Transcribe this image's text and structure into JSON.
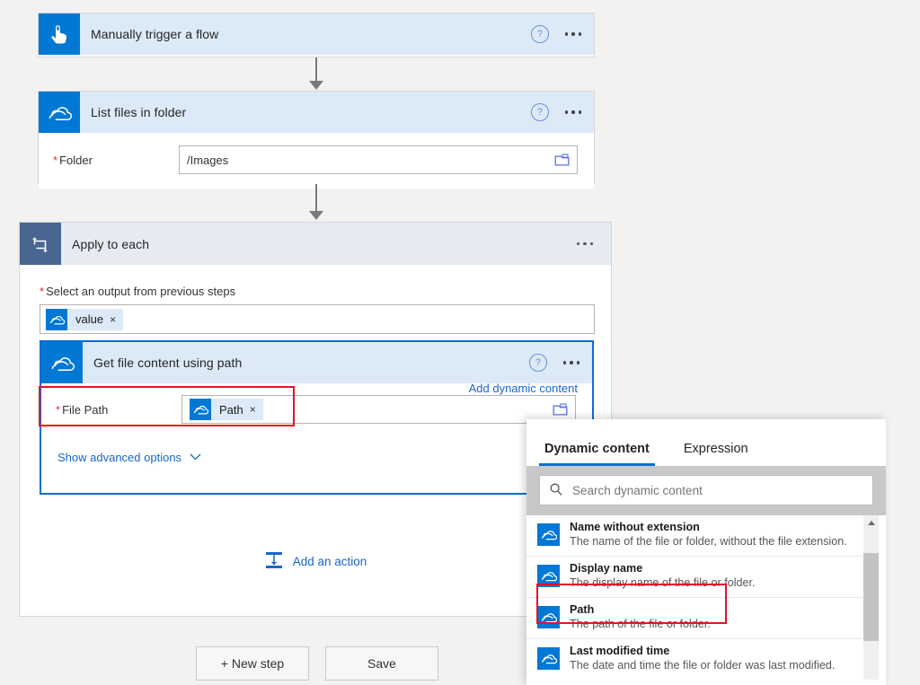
{
  "theme": {
    "accent": "#0078d4",
    "card_header_bg": "#dceaf7",
    "loop_header_bg": "#e6ebf2",
    "selected_border": "#0a6ed1",
    "annotation_red": "#e81123",
    "link_blue": "#1866c8",
    "canvas_bg": "#f3f2f1"
  },
  "flow": {
    "trigger_card": {
      "title": "Manually trigger a flow",
      "icon": "tap-hand-icon",
      "help_icon": "help-icon",
      "menu_icon": "ellipsis-icon"
    },
    "list_files_card": {
      "title": "List files in folder",
      "icon": "onedrive-cloud-icon",
      "help_icon": "help-icon",
      "menu_icon": "ellipsis-icon",
      "field": {
        "label": "Folder",
        "required": true,
        "value": "/Images",
        "picker_icon": "folder-picker-icon"
      }
    },
    "apply_to_each": {
      "title": "Apply to each",
      "icon": "loop-icon",
      "menu_icon": "ellipsis-icon",
      "select_output": {
        "label": "Select an output from previous steps",
        "required": true,
        "token": {
          "text": "value",
          "icon": "onedrive-cloud-icon",
          "remove": "×"
        }
      },
      "inner_card": {
        "title": "Get file content using path",
        "icon": "onedrive-cloud-icon",
        "help_icon": "help-icon",
        "menu_icon": "ellipsis-icon",
        "field": {
          "label": "File Path",
          "required": true,
          "token": {
            "text": "Path",
            "icon": "onedrive-cloud-icon",
            "remove": "×"
          },
          "picker_icon": "folder-picker-icon"
        },
        "add_dynamic_content": "Add dynamic content",
        "show_advanced": "Show advanced options",
        "chevron": "chevron-down-icon"
      },
      "add_action": {
        "label": "Add an action",
        "icon": "add-action-icon"
      }
    },
    "footer": {
      "new_step": "+ New step",
      "save": "Save"
    }
  },
  "dynamic_content_panel": {
    "tabs": [
      {
        "label": "Dynamic content",
        "active": true
      },
      {
        "label": "Expression",
        "active": false
      }
    ],
    "search": {
      "placeholder": "Search dynamic content",
      "icon": "search-icon"
    },
    "items": [
      {
        "name": "Name without extension",
        "description": "The name of the file or folder, without the file extension.",
        "icon": "onedrive-cloud-icon",
        "highlighted": false
      },
      {
        "name": "Display name",
        "description": "The display name of the file or folder.",
        "icon": "onedrive-cloud-icon",
        "highlighted": false
      },
      {
        "name": "Path",
        "description": "The path of the file or folder.",
        "icon": "onedrive-cloud-icon",
        "highlighted": true
      },
      {
        "name": "Last modified time",
        "description": "The date and time the file or folder was last modified.",
        "icon": "onedrive-cloud-icon",
        "highlighted": false
      }
    ],
    "scrollbar": {
      "up_arrow": "scroll-up-arrow-icon"
    }
  }
}
